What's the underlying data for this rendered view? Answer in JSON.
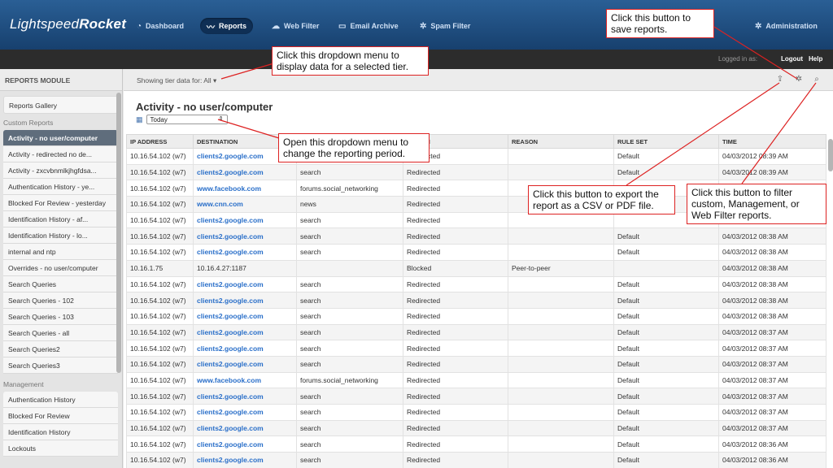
{
  "app": {
    "logo_light": "Lightspeed",
    "logo_bold": "Rocket"
  },
  "nav": {
    "items": [
      {
        "label": "Dashboard",
        "icon": "gauge-icon"
      },
      {
        "label": "Reports",
        "icon": "pulse-icon",
        "active": true
      },
      {
        "label": "Web Filter",
        "icon": "cloud-icon"
      },
      {
        "label": "Email Archive",
        "icon": "inbox-icon"
      },
      {
        "label": "Spam Filter",
        "icon": "gear-icon"
      }
    ],
    "admin_label": "Administration"
  },
  "subbar": {
    "logged_in": "Logged in as:",
    "logout": "Logout",
    "help": "Help"
  },
  "sidebar": {
    "heading": "REPORTS MODULE",
    "gallery": "Reports Gallery",
    "custom_label": "Custom Reports",
    "custom_items": [
      "Activity - no user/computer",
      "Activity - redirected no de...",
      "Activity - zxcvbnmlkjhgfdsa...",
      "Authentication History - ye...",
      "Blocked For Review - yesterday",
      "Identification History - af...",
      "Identification History - lo...",
      "internal and ntp",
      "Overrides - no user/computer",
      "Search Queries",
      "Search Queries - 102",
      "Search Queries - 103",
      "Search Queries - all",
      "Search Queries2",
      "Search Queries3"
    ],
    "management_label": "Management",
    "management_items": [
      "Authentication History",
      "Blocked For Review",
      "Identification History",
      "Lockouts"
    ]
  },
  "main": {
    "tier_text": "Showing tier data for: All",
    "report_title": "Activity - no user/computer",
    "period_value": "Today",
    "columns": [
      "IP ADDRESS",
      "DESTINATION",
      "CATEGORY",
      "ACTION",
      "REASON",
      "RULE SET",
      "TIME"
    ],
    "rows": [
      [
        "10.16.54.102 (w7)",
        "clients2.google.com",
        "",
        "Redirected",
        "",
        "Default",
        "04/03/2012 08:39 AM"
      ],
      [
        "10.16.54.102 (w7)",
        "clients2.google.com",
        "search",
        "Redirected",
        "",
        "Default",
        "04/03/2012 08:39 AM"
      ],
      [
        "10.16.54.102 (w7)",
        "www.facebook.com",
        "forums.social_networking",
        "Redirected",
        "",
        "",
        ""
      ],
      [
        "10.16.54.102 (w7)",
        "www.cnn.com",
        "news",
        "Redirected",
        "",
        "",
        ""
      ],
      [
        "10.16.54.102 (w7)",
        "clients2.google.com",
        "search",
        "Redirected",
        "",
        "",
        ""
      ],
      [
        "10.16.54.102 (w7)",
        "clients2.google.com",
        "search",
        "Redirected",
        "",
        "Default",
        "04/03/2012 08:38 AM"
      ],
      [
        "10.16.54.102 (w7)",
        "clients2.google.com",
        "search",
        "Redirected",
        "",
        "Default",
        "04/03/2012 08:38 AM"
      ],
      [
        "10.16.1.75",
        "10.16.4.27:1187",
        "",
        "Blocked",
        "Peer-to-peer",
        "",
        "04/03/2012 08:38 AM"
      ],
      [
        "10.16.54.102 (w7)",
        "clients2.google.com",
        "search",
        "Redirected",
        "",
        "Default",
        "04/03/2012 08:38 AM"
      ],
      [
        "10.16.54.102 (w7)",
        "clients2.google.com",
        "search",
        "Redirected",
        "",
        "Default",
        "04/03/2012 08:38 AM"
      ],
      [
        "10.16.54.102 (w7)",
        "clients2.google.com",
        "search",
        "Redirected",
        "",
        "Default",
        "04/03/2012 08:38 AM"
      ],
      [
        "10.16.54.102 (w7)",
        "clients2.google.com",
        "search",
        "Redirected",
        "",
        "Default",
        "04/03/2012 08:37 AM"
      ],
      [
        "10.16.54.102 (w7)",
        "clients2.google.com",
        "search",
        "Redirected",
        "",
        "Default",
        "04/03/2012 08:37 AM"
      ],
      [
        "10.16.54.102 (w7)",
        "clients2.google.com",
        "search",
        "Redirected",
        "",
        "Default",
        "04/03/2012 08:37 AM"
      ],
      [
        "10.16.54.102 (w7)",
        "www.facebook.com",
        "forums.social_networking",
        "Redirected",
        "",
        "Default",
        "04/03/2012 08:37 AM"
      ],
      [
        "10.16.54.102 (w7)",
        "clients2.google.com",
        "search",
        "Redirected",
        "",
        "Default",
        "04/03/2012 08:37 AM"
      ],
      [
        "10.16.54.102 (w7)",
        "clients2.google.com",
        "search",
        "Redirected",
        "",
        "Default",
        "04/03/2012 08:37 AM"
      ],
      [
        "10.16.54.102 (w7)",
        "clients2.google.com",
        "search",
        "Redirected",
        "",
        "Default",
        "04/03/2012 08:37 AM"
      ],
      [
        "10.16.54.102 (w7)",
        "clients2.google.com",
        "search",
        "Redirected",
        "",
        "Default",
        "04/03/2012 08:36 AM"
      ],
      [
        "10.16.54.102 (w7)",
        "clients2.google.com",
        "search",
        "Redirected",
        "",
        "Default",
        "04/03/2012 08:36 AM"
      ]
    ]
  },
  "callouts": {
    "save": "Click this button to save reports.",
    "tier": "Click this dropdown menu to display data for a selected tier.",
    "period": "Open this dropdown menu to change the reporting period.",
    "export": "Click this button to export the report as a CSV or PDF file.",
    "filter": "Click this button to filter custom, Management, or Web Filter reports."
  },
  "colors": {
    "nav_top": "#2a5f95",
    "nav_bottom": "#17406e",
    "callout_border": "#dd2222",
    "link_blue": "#2a6fc9"
  }
}
